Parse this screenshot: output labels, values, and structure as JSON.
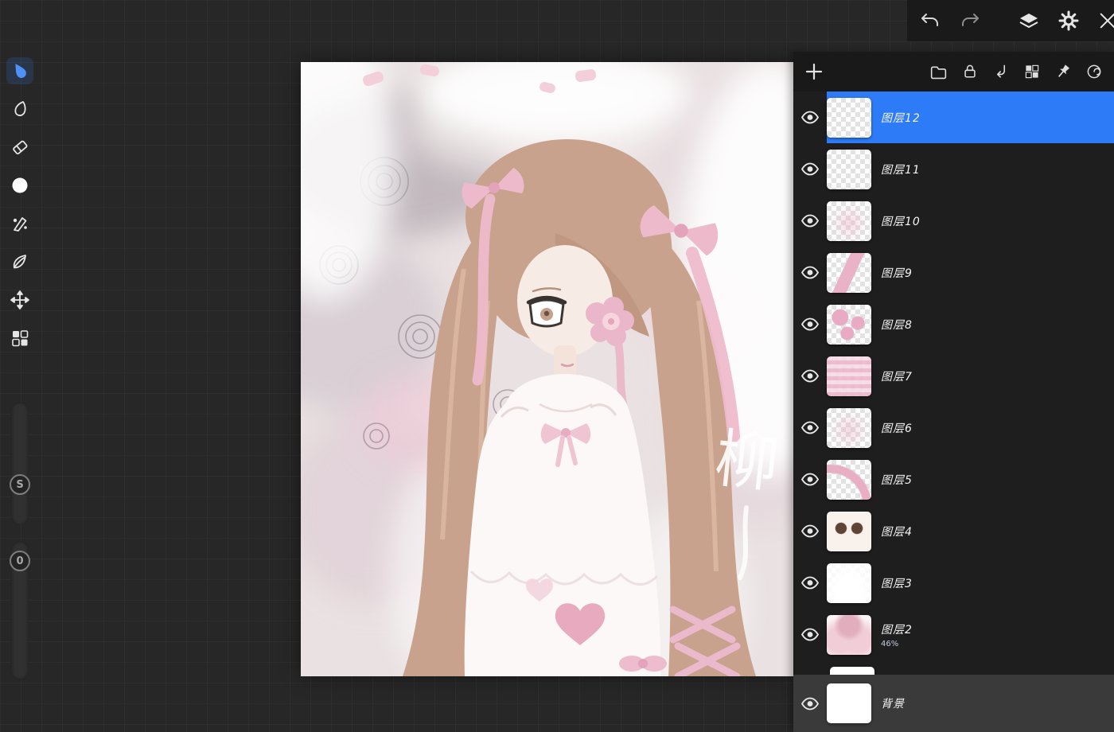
{
  "accent_color": "#2e7bf7",
  "topbar": {
    "icons": [
      "undo",
      "redo",
      "layers-stack",
      "settings-gear",
      "close"
    ]
  },
  "toolbar": {
    "tools": [
      {
        "name": "brush",
        "selected": true
      },
      {
        "name": "smudge",
        "selected": false
      },
      {
        "name": "eraser",
        "selected": false
      },
      {
        "name": "color-swatch",
        "selected": false
      },
      {
        "name": "mixer-brush",
        "selected": false
      },
      {
        "name": "vector-leaf",
        "selected": false
      },
      {
        "name": "transform-move",
        "selected": false
      },
      {
        "name": "pattern-grid",
        "selected": false
      }
    ],
    "slider_s_label": "S",
    "slider_o_label": "0"
  },
  "canvas": {
    "signature_text": "柳"
  },
  "layers_panel": {
    "header_icons": [
      "add-layer",
      "folder",
      "lock",
      "import",
      "transparency-checker",
      "pin",
      "spiral"
    ],
    "layers": [
      {
        "name": "图层12",
        "selected": true,
        "thumb": "empty"
      },
      {
        "name": "图层11",
        "selected": false,
        "thumb": "empty"
      },
      {
        "name": "图层10",
        "selected": false,
        "thumb": "faint"
      },
      {
        "name": "图层9",
        "selected": false,
        "thumb": "ribbon"
      },
      {
        "name": "图层8",
        "selected": false,
        "thumb": "dots"
      },
      {
        "name": "图层7",
        "selected": false,
        "thumb": "plaid"
      },
      {
        "name": "图层6",
        "selected": false,
        "thumb": "faint"
      },
      {
        "name": "图层5",
        "selected": false,
        "thumb": "curve"
      },
      {
        "name": "图层4",
        "selected": false,
        "thumb": "eyes"
      },
      {
        "name": "图层3",
        "selected": false,
        "thumb": "dress"
      },
      {
        "name": "图层2",
        "selected": false,
        "opacity": "46%",
        "thumb": "character"
      }
    ],
    "background_layer": {
      "name": "背景",
      "thumb": "white"
    }
  }
}
